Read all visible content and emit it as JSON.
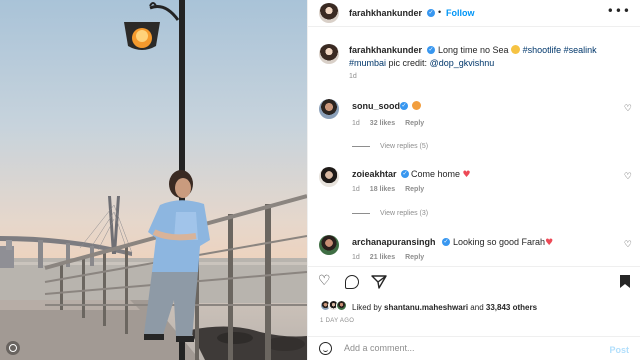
{
  "post": {
    "author": "farahkhankunder",
    "follow_label": "Follow",
    "separator": "•",
    "more_icon": "more-horizontal-icon"
  },
  "caption": {
    "username": "farahkhankunder",
    "text": "Long time no Sea",
    "hashtags_line1": "#shootlife #sealink",
    "hashtags_line2": "#mumbai",
    "credit_prefix": "pic credit:",
    "credit_handle": "@dop_gkvishnu",
    "time": "1d"
  },
  "comments": [
    {
      "username": "sonu_sood",
      "text": "",
      "emoji": "heart-eyes-emoji",
      "time": "1d",
      "likes": "32 likes",
      "reply_label": "Reply",
      "view_replies": "View replies (5)"
    },
    {
      "username": "zoieakhtar",
      "text": "Come home",
      "emoji": "red-heart-emoji",
      "time": "1d",
      "likes": "18 likes",
      "reply_label": "Reply",
      "view_replies": "View replies (3)"
    },
    {
      "username": "archanapuransingh",
      "text": "Looking so good Farah",
      "emoji": "red-heart-emoji",
      "time": "1d",
      "likes": "21 likes",
      "reply_label": "Reply"
    }
  ],
  "actions": {
    "icons": [
      "heart-icon",
      "comment-icon",
      "share-icon",
      "bookmark-icon"
    ]
  },
  "likes": {
    "prefix": "Liked by",
    "user": "shantanu.maheshwari",
    "middle": "and",
    "others": "33,843 others",
    "posted_ago": "1 DAY AGO"
  },
  "composer": {
    "placeholder": "Add a comment...",
    "post_label": "Post"
  },
  "colors": {
    "link_blue": "#0095f6",
    "hashtag": "#00376b",
    "verified": "#3897f0",
    "muted": "#8e8e8e",
    "like_red": "#ed4956"
  }
}
